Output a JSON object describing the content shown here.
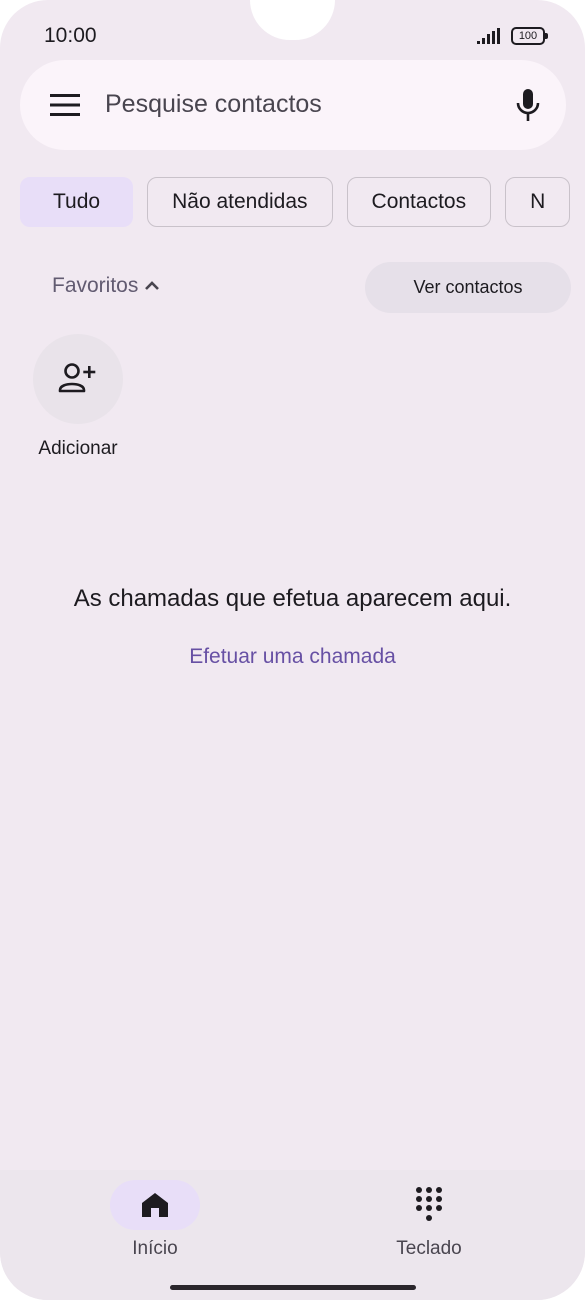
{
  "status_bar": {
    "time": "10:00",
    "battery": "100"
  },
  "search": {
    "placeholder": "Pesquise contactos",
    "menu_icon": "hamburger-menu-icon",
    "mic_icon": "microphone-icon"
  },
  "filters": {
    "chips": [
      "Tudo",
      "Não atendidas",
      "Contactos",
      "N"
    ],
    "selected": "Tudo"
  },
  "favorites": {
    "label": "Favoritos",
    "toggle_icon": "chevron-up-icon",
    "view_contacts_label": "Ver contactos",
    "add_label": "Adicionar",
    "add_icon": "person-add-icon"
  },
  "main": {
    "empty_message": "As chamadas que efetua aparecem aqui.",
    "call_link": "Efetuar uma chamada"
  },
  "bottom_nav": {
    "items": [
      {
        "label": "Início",
        "icon": "home-icon",
        "active": true
      },
      {
        "label": "Teclado",
        "icon": "dialpad-icon",
        "active": false
      }
    ]
  },
  "colors": {
    "background": "#f1e9f1",
    "accent": "#6750a4",
    "chip_selected": "#e8def8"
  }
}
